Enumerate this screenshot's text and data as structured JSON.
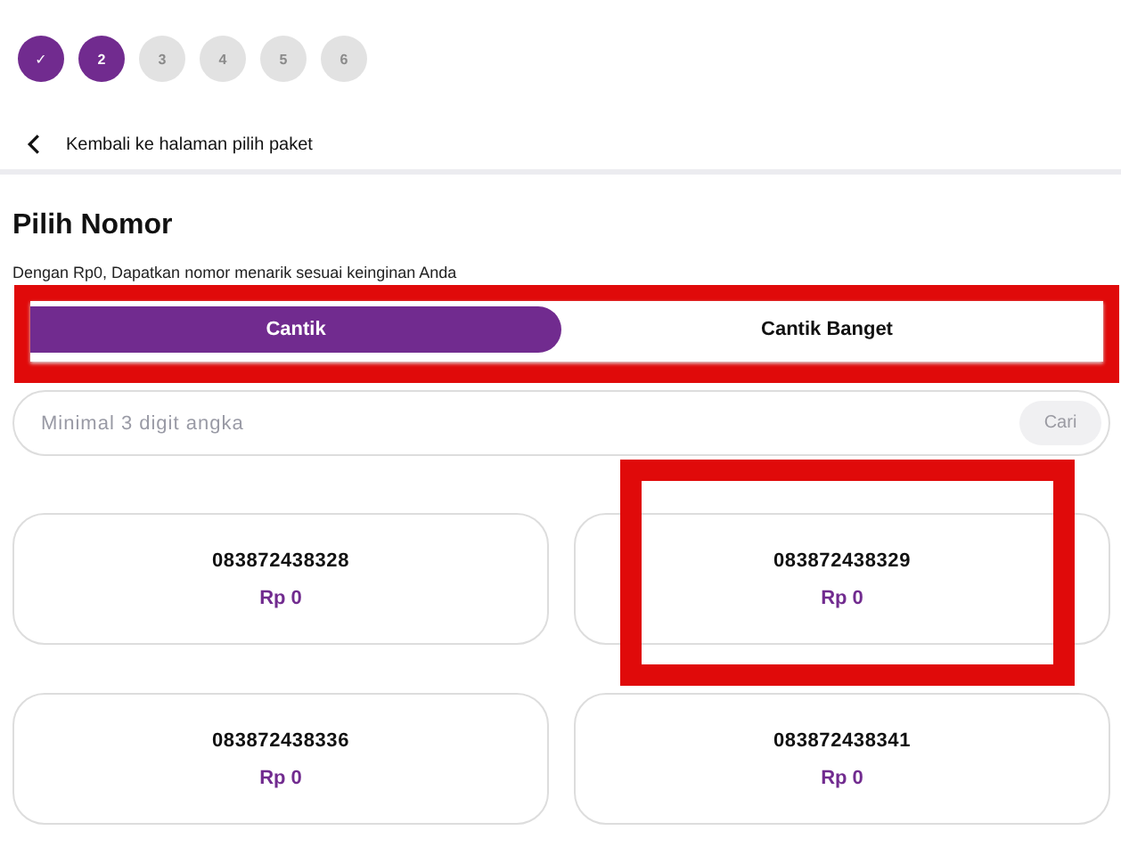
{
  "steps": [
    {
      "label": "✓",
      "done": true
    },
    {
      "label": "2",
      "done": true
    },
    {
      "label": "3",
      "done": false
    },
    {
      "label": "4",
      "done": false
    },
    {
      "label": "5",
      "done": false
    },
    {
      "label": "6",
      "done": false
    }
  ],
  "back": {
    "label": "Kembali ke halaman pilih paket"
  },
  "title": "Pilih Nomor",
  "subtitle": "Dengan Rp0, Dapatkan nomor menarik sesuai keinginan Anda",
  "tab_bar": {
    "highlighted": true,
    "tabs": [
      {
        "label": "Cantik",
        "selected": true
      },
      {
        "label": "Cantik Banget",
        "selected": false
      }
    ]
  },
  "search": {
    "placeholder": "Minimal 3 digit angka",
    "button": "Cari",
    "disabled": true
  },
  "numbers": [
    {
      "number": "083872438328",
      "price": "Rp 0",
      "highlighted": false
    },
    {
      "number": "083872438329",
      "price": "Rp 0",
      "highlighted": true
    },
    {
      "number": "083872438336",
      "price": "Rp 0",
      "highlighted": false
    },
    {
      "number": "083872438341",
      "price": "Rp 0",
      "highlighted": false
    }
  ]
}
